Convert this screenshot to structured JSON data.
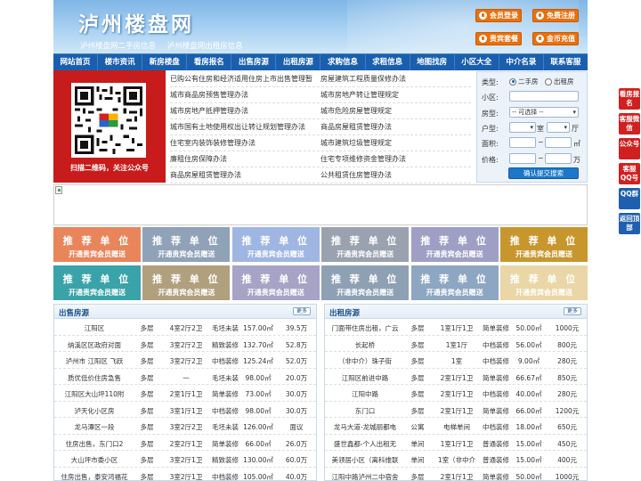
{
  "header": {
    "title": "泸州楼盘网",
    "subtitles": [
      "泸州楼盘网二手房信息",
      "泸州楼盘网出租房信息"
    ],
    "buttons": [
      {
        "label": "会员登录",
        "icon": "user-icon"
      },
      {
        "label": "免费注册",
        "icon": "register-icon"
      },
      {
        "label": "贵宾套餐",
        "icon": "vip-icon"
      },
      {
        "label": "金币充值",
        "icon": "coin-icon"
      }
    ]
  },
  "nav": [
    "网站首页",
    "楼市资讯",
    "新房楼盘",
    "看房报名",
    "出售房源",
    "出租房源",
    "求购信息",
    "求租信息",
    "地图找房",
    "小区大全",
    "中介名录",
    "联系客服"
  ],
  "qr": {
    "caption": "扫描二维码，关注公众号"
  },
  "policy_links": [
    [
      "已购公有住房和经济适用住房上市出售管理暂",
      "房屋建筑工程质量保修办法"
    ],
    [
      "城市商品房预售管理办法",
      "城市房地产转让管理规定"
    ],
    [
      "城市房地产抵押管理办法",
      "城市危险房屋管理规定"
    ],
    [
      "城市国有土地使用权出让转让规划管理办法",
      "商品房屋租赁管理办法"
    ],
    [
      "住宅室内装饰装修管理办法",
      "城市建筑垃圾管理规定"
    ],
    [
      "廉租住房保障办法",
      "住宅专项维修资金管理办法"
    ],
    [
      "商品房屋租赁管理办法",
      "公共租赁住房管理办法"
    ]
  ],
  "search": {
    "type_label": "类型:",
    "type_options": [
      "二手房",
      "出租房"
    ],
    "type_selected": "二手房",
    "community_label": "小区:",
    "community_value": "",
    "house_type_label": "房型:",
    "house_type_value": "-- 可选择 --",
    "layout_label": "户型:",
    "layout_room_unit": "室",
    "layout_hall_unit": "厅",
    "area_label": "面积:",
    "area_unit": "㎡",
    "price_label": "价格:",
    "price_unit": "万",
    "range_sep": "~",
    "submit": "确认提交搜索"
  },
  "ads": {
    "title": "推 荐 单 位",
    "subtitle": "开通贵宾会员赠送",
    "colors": [
      "#e9855b",
      "#8fa2b8",
      "#9fb5e2",
      "#9aa2af",
      "#9f9fc5",
      "#c7962d",
      "#3aa3a9",
      "#b0a07e",
      "#a6a3c6",
      "#8ea0b4",
      "#8da6c2",
      "#ead6a6"
    ]
  },
  "sale_listings": {
    "title": "出售房源",
    "more": "更多",
    "rows": [
      [
        "江阳区",
        "多层",
        "4室2厅2卫",
        "毛坯未装",
        "157.00㎡",
        "39.5万"
      ],
      [
        "纳溪区区政府对面",
        "多层",
        "3室2厅2卫",
        "精致装修",
        "132.70㎡",
        "52.8万"
      ],
      [
        "泸州市 江阳区 飞跃",
        "多层",
        "3室2厅2卫",
        "中档装修",
        "125.24㎡",
        "52.0万"
      ],
      [
        "质优低价住房急售",
        "多层",
        "一",
        "毛坯未装",
        "98.00㎡",
        "20.0万"
      ],
      [
        "江阳区大山坪110附",
        "多层",
        "2室1厅1卫",
        "简单装修",
        "73.00㎡",
        "30.0万"
      ],
      [
        "泸天化小区房",
        "多层",
        "3室1厅1卫",
        "中档装修",
        "98.00㎡",
        "30.0万"
      ],
      [
        "龙马潭区一段",
        "多层",
        "3室2厅2卫",
        "毛坯未装",
        "126.00㎡",
        "面议"
      ],
      [
        "住房出售，东门口2",
        "多层",
        "2室2厅1卫",
        "简单装修",
        "66.00㎡",
        "26.0万"
      ],
      [
        "大山坪市委小区",
        "多层",
        "3室2厅1卫",
        "精致装修",
        "130.00㎡",
        "60.0万"
      ],
      [
        "住房出售，泰安鸿福花",
        "多层",
        "3室2厅1卫",
        "中档装修",
        "105.00㎡",
        "40.0万"
      ]
    ]
  },
  "rent_listings": {
    "title": "出租房源",
    "more": "更多",
    "rows": [
      [
        "门面带住房出租，广云",
        "多层",
        "1室1厅1卫",
        "简单装修",
        "50.00㎡",
        "1000元"
      ],
      [
        "长起桥",
        "多层",
        "1室1厅",
        "中档装修",
        "56.00㎡",
        "800元"
      ],
      [
        "（非中介）珠子街",
        "多层",
        "1室",
        "中档装修",
        "9.00㎡",
        "280元"
      ],
      [
        "江阳区前进中路",
        "多层",
        "2室1厅1卫",
        "简单装修",
        "66.67㎡",
        "850元"
      ],
      [
        "江阳中路",
        "多层",
        "2室1厅1卫",
        "中档装修",
        "40.00㎡",
        "280元"
      ],
      [
        "东门口",
        "多层",
        "2室1厅1卫",
        "简单装修",
        "66.00㎡",
        "1200元"
      ],
      [
        "龙马大道-龙城丽都电",
        "公寓",
        "电梯单间",
        "中档装修",
        "18.00㎡",
        "650元"
      ],
      [
        "盛世鑫都-个人出租无",
        "单间",
        "1室1厅1卫",
        "普通装修",
        "15.00㎡",
        "450元"
      ],
      [
        "美领居小区（离科维联",
        "单间",
        "1室（非中介",
        "普通装修",
        "15.00㎡",
        "400元"
      ],
      [
        "江阳中路泸州二中宿舍",
        "多层",
        "2室1厅1卫",
        "简单装修",
        "50.00㎡",
        "1000元"
      ]
    ]
  },
  "side_buttons": [
    {
      "label": "看房报名",
      "icon": "house-tour-icon"
    },
    {
      "label": "客服微信",
      "icon": "wechat-icon"
    },
    {
      "label": "公众号",
      "icon": "official-account-icon"
    },
    {
      "label": "客服QQ号",
      "icon": "qq-icon"
    },
    {
      "label": "QQ群",
      "icon": "qq-group-icon"
    },
    {
      "label": "返回顶部",
      "icon": "back-to-top-icon"
    }
  ]
}
